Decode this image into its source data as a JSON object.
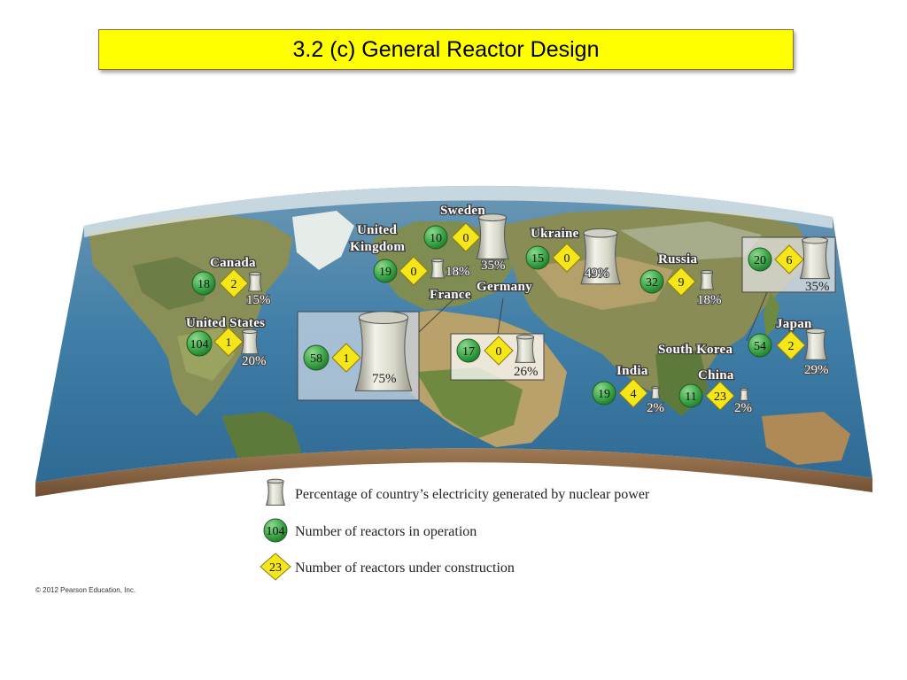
{
  "slide": {
    "title": "3.2 (c)  General Reactor Design",
    "copyright": "© 2012 Pearson Education, Inc."
  },
  "countries": [
    {
      "name": "Canada",
      "operating": "18",
      "construction": "2",
      "percent": "15%"
    },
    {
      "name": "United States",
      "operating": "104",
      "construction": "1",
      "percent": "20%"
    },
    {
      "name": "United Kingdom",
      "operating": "19",
      "construction": "0",
      "percent": "18%"
    },
    {
      "name": "Sweden",
      "operating": "10",
      "construction": "0",
      "percent": "35%"
    },
    {
      "name": "France",
      "operating": "58",
      "construction": "1",
      "percent": "75%"
    },
    {
      "name": "Germany",
      "operating": "17",
      "construction": "0",
      "percent": "26%"
    },
    {
      "name": "Ukraine",
      "operating": "15",
      "construction": "0",
      "percent": "49%"
    },
    {
      "name": "Russia",
      "operating": "32",
      "construction": "9",
      "percent": "18%"
    },
    {
      "name": "South Korea",
      "operating": "20",
      "construction": "6",
      "percent": "35%"
    },
    {
      "name": "Japan",
      "operating": "54",
      "construction": "2",
      "percent": "29%"
    },
    {
      "name": "India",
      "operating": "19",
      "construction": "4",
      "percent": "2%"
    },
    {
      "name": "China",
      "operating": "11",
      "construction": "23",
      "percent": "2%"
    }
  ],
  "legend": {
    "percent_label": "Percentage of country’s electricity generated by nuclear power",
    "operating_sample": "104",
    "operating_label": "Number of reactors in operation",
    "construction_sample": "23",
    "construction_label": "Number of reactors under construction"
  },
  "colors": {
    "title_bg": "#ffff00",
    "operating_marker": "#3fa84a",
    "construction_marker": "#f5e61a",
    "ocean": "#3f7fa8",
    "land": "#8a9a5a"
  }
}
